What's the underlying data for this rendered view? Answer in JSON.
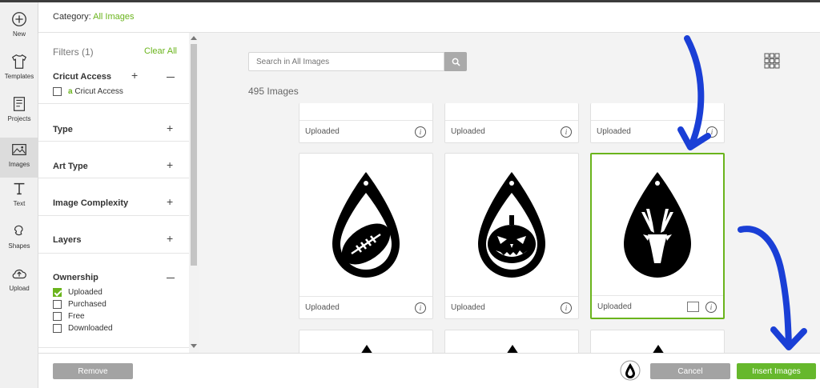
{
  "rail": [
    {
      "label": "New",
      "icon": "plus-circle-icon"
    },
    {
      "label": "Templates",
      "icon": "tshirt-icon"
    },
    {
      "label": "Projects",
      "icon": "notebook-icon"
    },
    {
      "label": "Images",
      "icon": "image-icon"
    },
    {
      "label": "Text",
      "icon": "text-icon"
    },
    {
      "label": "Shapes",
      "icon": "shapes-icon"
    },
    {
      "label": "Upload",
      "icon": "cloud-upload-icon"
    }
  ],
  "header": {
    "category_label": "Category:",
    "category_value": "All Images"
  },
  "filters": {
    "title": "Filters (1)",
    "clear_all": "Clear All",
    "cricut_access": {
      "name": "Cricut Access",
      "option": "Cricut Access"
    },
    "sections": [
      "Type",
      "Art Type",
      "Image Complexity",
      "Layers"
    ],
    "ownership": {
      "name": "Ownership",
      "options": [
        {
          "label": "Uploaded",
          "checked": true
        },
        {
          "label": "Purchased",
          "checked": false
        },
        {
          "label": "Free",
          "checked": false
        },
        {
          "label": "Downloaded",
          "checked": false
        }
      ]
    }
  },
  "main": {
    "search_placeholder": "Search in All Images",
    "count": "495 Images",
    "cards": [
      {
        "label": "Uploaded",
        "art": "football-earring"
      },
      {
        "label": "Uploaded",
        "art": "pumpkin-earring"
      },
      {
        "label": "Uploaded",
        "art": "deer-earring",
        "selected": true
      }
    ],
    "top_cards_label": "Uploaded"
  },
  "footer": {
    "remove": "Remove",
    "cancel": "Cancel",
    "insert": "Insert Images"
  },
  "colors": {
    "accent": "#6ab41c",
    "annotation_arrow": "#1a3fd6"
  }
}
